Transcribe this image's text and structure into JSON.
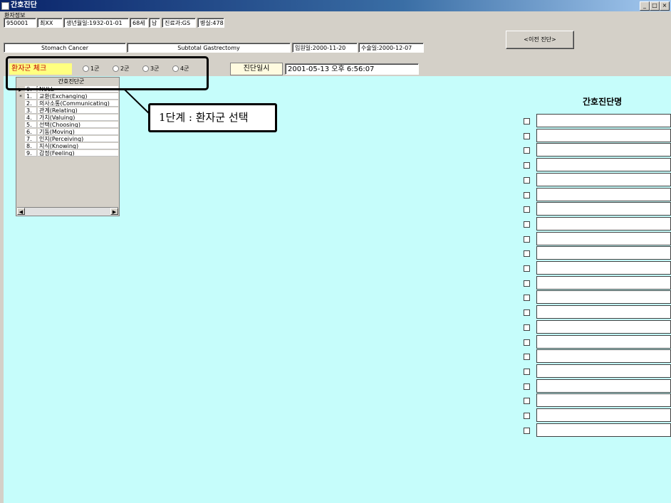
{
  "window": {
    "title": "간호진단",
    "subtitle": "환자정보",
    "controls": [
      "_",
      "□",
      "×"
    ]
  },
  "patient_info": [
    "950001",
    "최XX",
    "생년월일:1932-01-01",
    "68세",
    "남",
    "진료과:GS",
    "병실:478"
  ],
  "diagnosis_info": [
    "Stomach Cancer",
    "Subtotal Gastrectomy",
    "입원일:2000-11-20",
    "수술일:2000-12-07"
  ],
  "history_button": "<이전 진단>",
  "patient_group": {
    "label": "환자군 체크",
    "options": [
      "1군",
      "2군",
      "3군",
      "4군"
    ]
  },
  "diagnosis_time": {
    "label": "진단일시",
    "value": "2001-05-13 오후 6:56:07"
  },
  "grid": {
    "header": "간호진단군",
    "rows": [
      {
        "indicator": "▶",
        "num": "0.",
        "name": "NULL"
      },
      {
        "indicator": "*",
        "num": "1.",
        "name": "교환(Exchanging)"
      },
      {
        "indicator": "",
        "num": "2.",
        "name": "의사소통(Communicating)"
      },
      {
        "indicator": "",
        "num": "3.",
        "name": "관계(Relating)"
      },
      {
        "indicator": "",
        "num": "4.",
        "name": "가치(Valuing)"
      },
      {
        "indicator": "",
        "num": "5.",
        "name": "선택(Choosing)"
      },
      {
        "indicator": "",
        "num": "6.",
        "name": "기동(Moving)"
      },
      {
        "indicator": "",
        "num": "7.",
        "name": "인지(Perceiving)"
      },
      {
        "indicator": "",
        "num": "8.",
        "name": "지식(Knowing)"
      },
      {
        "indicator": "",
        "num": "9.",
        "name": "감정(Feeling)"
      }
    ]
  },
  "callout": "1단계 : 환자군 선택",
  "nursing_diagnosis": {
    "title": "간호진단명",
    "rows": [
      "",
      "",
      "",
      "",
      "",
      "",
      "",
      "",
      "",
      "",
      "",
      "",
      "",
      "",
      "",
      "",
      "",
      "",
      "",
      "",
      "",
      ""
    ]
  }
}
